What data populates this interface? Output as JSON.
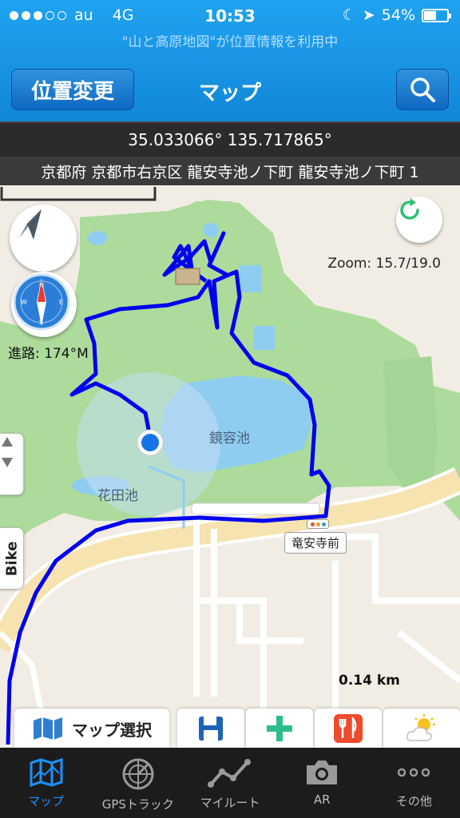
{
  "status": {
    "carrier": "au",
    "network": "4G",
    "time": "10:53",
    "battery": "54%",
    "battery_level": 0.54,
    "location_banner": "\"山と高原地図\"が位置情報を利用中"
  },
  "navbar": {
    "change_location_label": "位置変更",
    "title": "マップ",
    "search_icon": "search-icon"
  },
  "coords": "35.033066° 135.717865°",
  "address": "京都府 京都市右京区 龍安寺池ノ下町 龍安寺池ノ下町 1",
  "map": {
    "zoom": "Zoom: 15.7/19.0",
    "heading": "進路: 174°M",
    "labels": {
      "pond": "鏡容池",
      "hanada": "花田池",
      "bus_stop": "竜安寺前"
    },
    "scale": "0.14 km",
    "bike_label": "Bike",
    "colors": {
      "track": "#0000ee",
      "park": "#a9d99a",
      "water": "#8fcdf0",
      "road": "#f6e3b0"
    }
  },
  "toolbar": {
    "map_select_label": "マップ選択",
    "icons": [
      "floppy-disk-icon",
      "plus-icon",
      "restaurant-icon",
      "weather-icon"
    ]
  },
  "tabs": [
    {
      "label": "マップ",
      "icon": "map-icon",
      "active": true
    },
    {
      "label": "GPSトラック",
      "icon": "radar-icon",
      "active": false
    },
    {
      "label": "マイルート",
      "icon": "route-icon",
      "active": false
    },
    {
      "label": "AR",
      "icon": "camera-icon",
      "active": false
    },
    {
      "label": "その他",
      "icon": "more-icon",
      "active": false
    }
  ]
}
